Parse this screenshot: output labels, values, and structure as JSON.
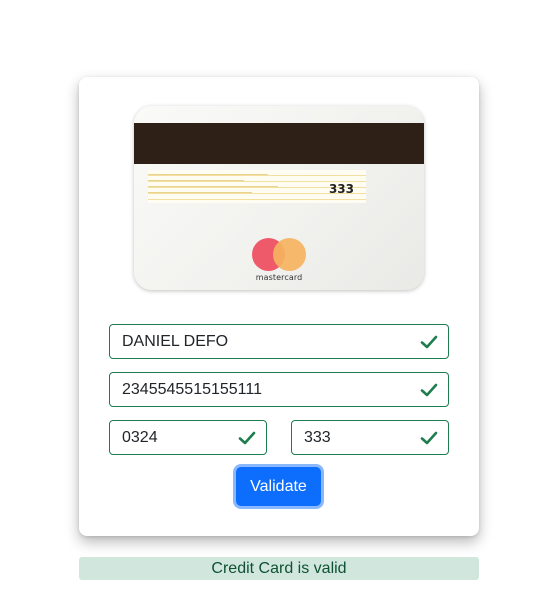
{
  "card_preview": {
    "cvv": "333",
    "brand": "mastercard",
    "brand_colors": {
      "red": "#ee5a6a",
      "yellow": "#f6b35f"
    }
  },
  "form": {
    "name": {
      "value": "DANIEL DEFO",
      "valid": true
    },
    "number": {
      "value": "2345545515155111",
      "valid": true
    },
    "expiry": {
      "value": "0324",
      "valid": true
    },
    "cvv": {
      "value": "333",
      "valid": true
    }
  },
  "validate_button": {
    "label": "Validate"
  },
  "status": {
    "message": "Credit Card is valid",
    "color": "#0f5132",
    "background": "#d1e7dd"
  },
  "accent": {
    "valid": "#1e7d4f",
    "primary": "#0d6efd"
  }
}
